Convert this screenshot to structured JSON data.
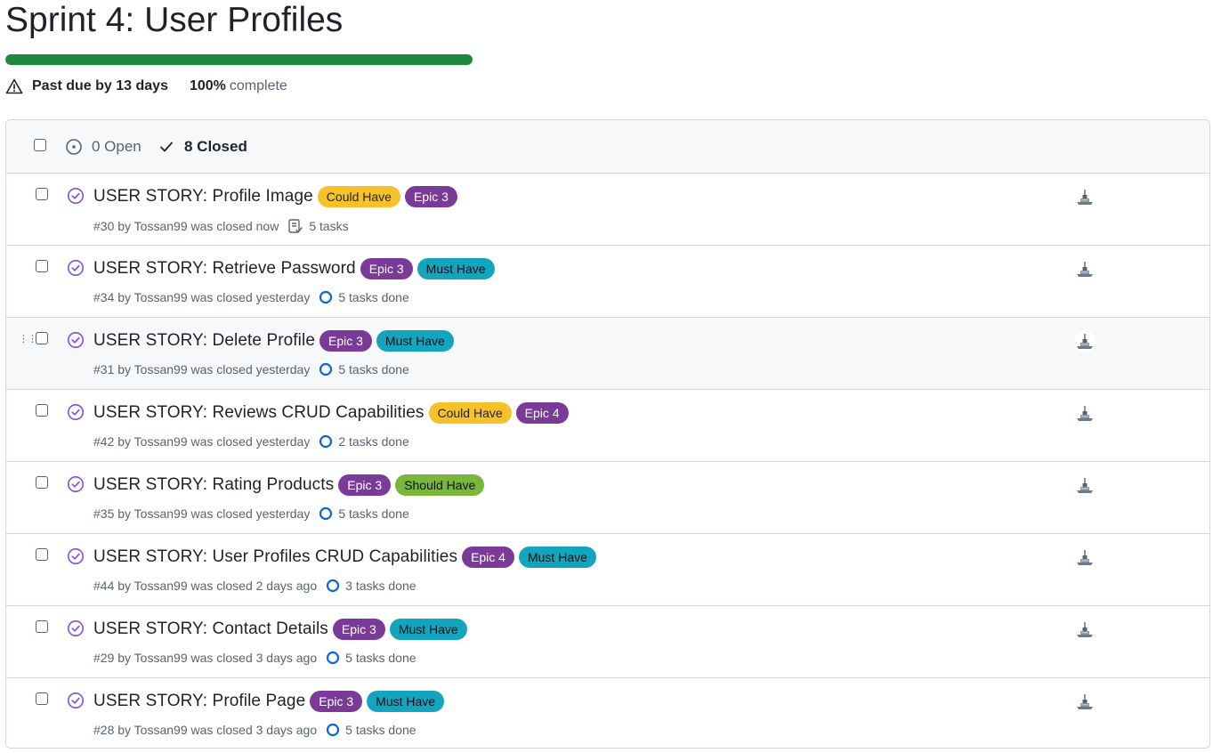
{
  "milestone": {
    "title": "Sprint 4: User Profiles",
    "progress": 1.0,
    "due_text": "Past due by 13 days",
    "percent": "100%",
    "percent_suffix": "complete"
  },
  "filters": {
    "open_label": "0 Open",
    "closed_label": "8 Closed"
  },
  "labels_colors": {
    "Could Have": {
      "bg": "#f7c12a",
      "fg": "#1f2328"
    },
    "Must Have": {
      "bg": "#13a5bd",
      "fg": "#0d1117"
    },
    "Should Have": {
      "bg": "#7bb63c",
      "fg": "#0d1117"
    },
    "Epic 3": {
      "bg": "#7a3a98",
      "fg": "#ffffff"
    },
    "Epic 4": {
      "bg": "#7a3a98",
      "fg": "#ffffff"
    }
  },
  "issues": [
    {
      "title": "USER STORY: Profile Image",
      "labels": [
        "Could Have",
        "Epic 3"
      ],
      "meta": "#30 by Tossan99 was closed now",
      "tasks": "5 tasks",
      "task_icon": "checklist-icon"
    },
    {
      "title": "USER STORY: Retrieve Password",
      "labels": [
        "Epic 3",
        "Must Have"
      ],
      "meta": "#34 by Tossan99 was closed yesterday",
      "tasks": "5 tasks done",
      "task_icon": "progress-circle-icon"
    },
    {
      "title": "USER STORY: Delete Profile",
      "labels": [
        "Epic 3",
        "Must Have"
      ],
      "meta": "#31 by Tossan99 was closed yesterday",
      "tasks": "5 tasks done",
      "task_icon": "progress-circle-icon"
    },
    {
      "title": "USER STORY: Reviews CRUD Capabilities",
      "labels": [
        "Could Have",
        "Epic 4"
      ],
      "meta": "#42 by Tossan99 was closed yesterday",
      "tasks": "2 tasks done",
      "task_icon": "progress-circle-icon"
    },
    {
      "title": "USER STORY: Rating Products",
      "labels": [
        "Epic 3",
        "Should Have"
      ],
      "meta": "#35 by Tossan99 was closed yesterday",
      "tasks": "5 tasks done",
      "task_icon": "progress-circle-icon"
    },
    {
      "title": "USER STORY: User Profiles CRUD Capabilities",
      "labels": [
        "Epic 4",
        "Must Have"
      ],
      "meta": "#44 by Tossan99 was closed 2 days ago",
      "tasks": "3 tasks done",
      "task_icon": "progress-circle-icon"
    },
    {
      "title": "USER STORY: Contact Details",
      "labels": [
        "Epic 3",
        "Must Have"
      ],
      "meta": "#29 by Tossan99 was closed 3 days ago",
      "tasks": "5 tasks done",
      "task_icon": "progress-circle-icon"
    },
    {
      "title": "USER STORY: Profile Page",
      "labels": [
        "Epic 3",
        "Must Have"
      ],
      "meta": "#28 by Tossan99 was closed 3 days ago",
      "tasks": "5 tasks done",
      "task_icon": "progress-circle-icon"
    }
  ]
}
